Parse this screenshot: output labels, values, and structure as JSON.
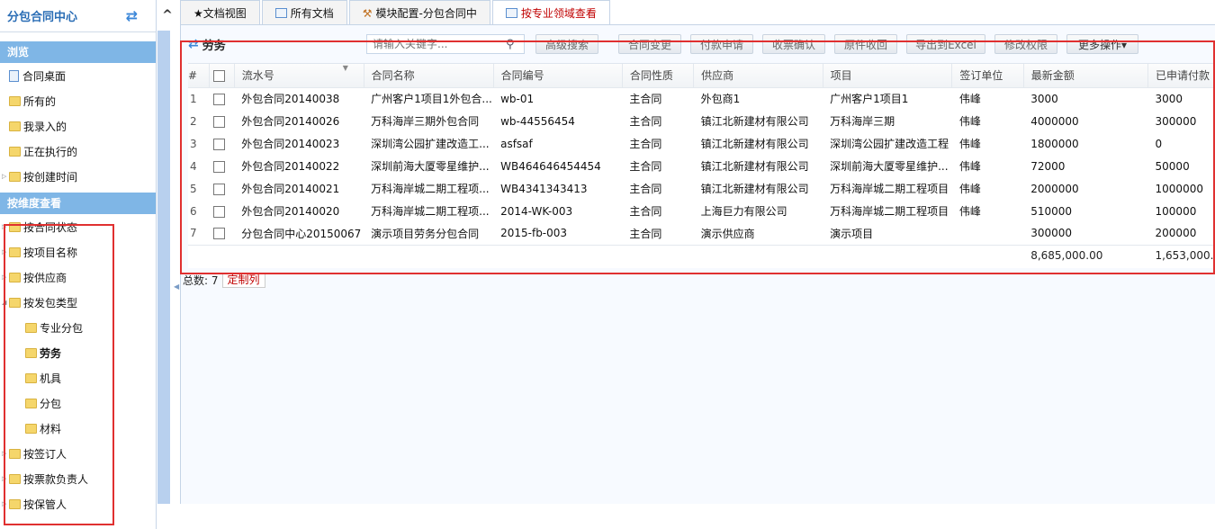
{
  "sidebar": {
    "title": "分包合同中心",
    "section_browse": "浏览",
    "browse_items": [
      {
        "label": "合同桌面",
        "icon": "doc-icon"
      },
      {
        "label": "所有的",
        "icon": "folder-icon"
      },
      {
        "label": "我录入的",
        "icon": "folder-icon"
      },
      {
        "label": "正在执行的",
        "icon": "folder-icon"
      },
      {
        "label": "按创建时间",
        "icon": "folder-icon"
      }
    ],
    "section_dimension": "按维度查看",
    "dimension_items": [
      {
        "label": "按合同状态"
      },
      {
        "label": "按项目名称"
      },
      {
        "label": "按供应商"
      },
      {
        "label": "按发包类型"
      },
      {
        "label": "专业分包"
      },
      {
        "label": "劳务"
      },
      {
        "label": "机具"
      },
      {
        "label": "分包"
      },
      {
        "label": "材料"
      },
      {
        "label": "按签订人"
      },
      {
        "label": "按票款负责人"
      },
      {
        "label": "按保管人"
      }
    ]
  },
  "tabs": [
    {
      "label": "★文档视图"
    },
    {
      "label": "所有文档"
    },
    {
      "label": "模块配置-分包合同中"
    },
    {
      "label": "按专业领域查看"
    }
  ],
  "grid": {
    "title": "劳务",
    "search_placeholder": "请输入关键字...",
    "toolbar_buttons": [
      "高级搜索",
      "合同变更",
      "付款申请",
      "收票确认",
      "原件收回",
      "导出到Excel",
      "修改权限",
      "更多操作▾"
    ],
    "columns": [
      "#",
      "",
      "流水号",
      "合同名称",
      "合同编号",
      "合同性质",
      "供应商",
      "项目",
      "签订单位",
      "最新金额",
      "已申请付款"
    ],
    "rows": [
      {
        "no": "1",
        "serial": "外包合同20140038",
        "name": "广州客户1项目1外包合...",
        "code": "wb-01",
        "nature": "主合同",
        "supplier": "外包商1",
        "project": "广州客户1项目1",
        "signer": "伟峰",
        "amount": "3000",
        "applied": "3000"
      },
      {
        "no": "2",
        "serial": "外包合同20140026",
        "name": "万科海岸三期外包合同",
        "code": "wb-44556454",
        "nature": "主合同",
        "supplier": "镇江北新建材有限公司",
        "project": "万科海岸三期",
        "signer": "伟峰",
        "amount": "4000000",
        "applied": "300000"
      },
      {
        "no": "3",
        "serial": "外包合同20140023",
        "name": "深圳湾公园扩建改造工...",
        "code": "asfsaf",
        "nature": "主合同",
        "supplier": "镇江北新建材有限公司",
        "project": "深圳湾公园扩建改造工程",
        "signer": "伟峰",
        "amount": "1800000",
        "applied": "0"
      },
      {
        "no": "4",
        "serial": "外包合同20140022",
        "name": "深圳前海大厦零星维护...",
        "code": "WB464646454454",
        "nature": "主合同",
        "supplier": "镇江北新建材有限公司",
        "project": "深圳前海大厦零星维护...",
        "signer": "伟峰",
        "amount": "72000",
        "applied": "50000"
      },
      {
        "no": "5",
        "serial": "外包合同20140021",
        "name": "万科海岸城二期工程项...",
        "code": "WB4341343413",
        "nature": "主合同",
        "supplier": "镇江北新建材有限公司",
        "project": "万科海岸城二期工程项目",
        "signer": "伟峰",
        "amount": "2000000",
        "applied": "1000000"
      },
      {
        "no": "6",
        "serial": "外包合同20140020",
        "name": "万科海岸城二期工程项...",
        "code": "2014-WK-003",
        "nature": "主合同",
        "supplier": "上海巨力有限公司",
        "project": "万科海岸城二期工程项目",
        "signer": "伟峰",
        "amount": "510000",
        "applied": "100000"
      },
      {
        "no": "7",
        "serial": "分包合同中心20150067",
        "name": "演示项目劳务分包合同",
        "code": "2015-fb-003",
        "nature": "主合同",
        "supplier": "演示供应商",
        "project": "演示项目",
        "signer": "",
        "amount": "300000",
        "applied": "200000"
      }
    ],
    "totals": {
      "amount": "8,685,000.00",
      "applied": "1,653,000."
    },
    "footer_total_label": "总数:",
    "footer_total_count": "7",
    "customize_label": "定制列"
  },
  "colors": {
    "accent": "#2a6db5",
    "section_bg": "#7fb6e6",
    "highlight": "#e03030",
    "active_tab": "#c00000"
  }
}
